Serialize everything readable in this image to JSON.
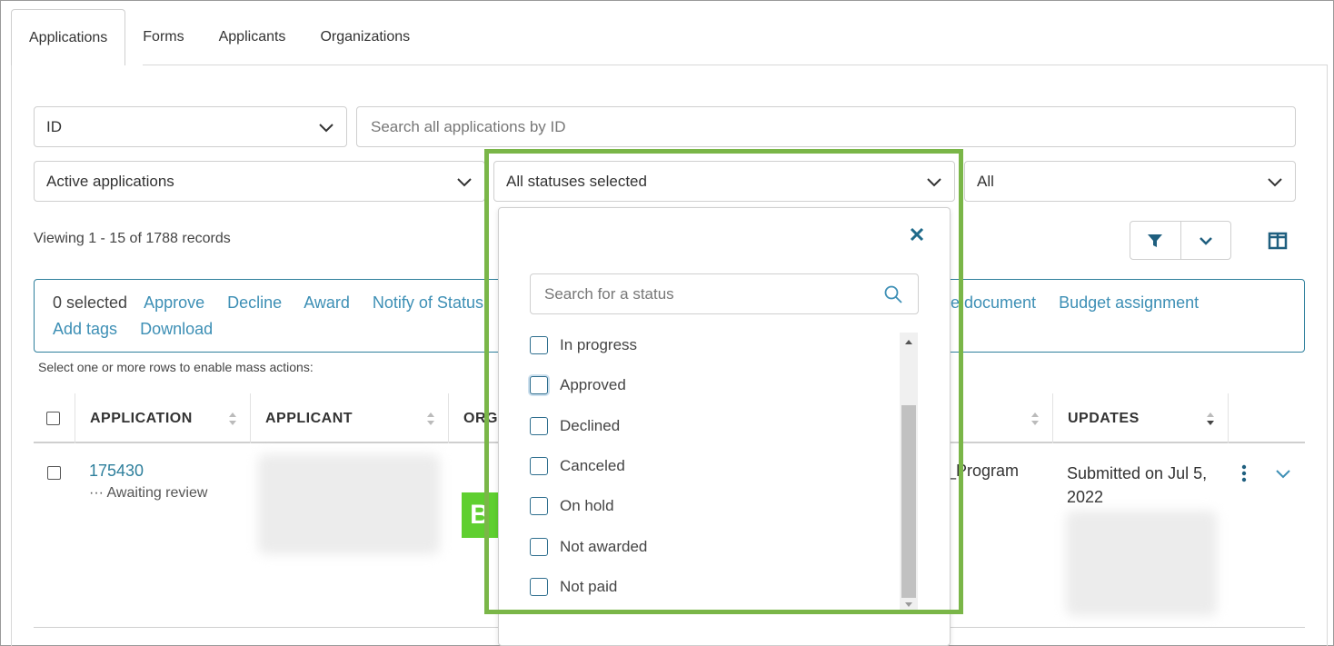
{
  "tabs": [
    {
      "label": "Applications"
    },
    {
      "label": "Forms"
    },
    {
      "label": "Applicants"
    },
    {
      "label": "Organizations"
    }
  ],
  "search": {
    "field_select": "ID",
    "placeholder": "Search all applications by ID"
  },
  "filters": {
    "applications": "Active applications",
    "statuses": "All statuses selected",
    "third": "All"
  },
  "records_text": "Viewing 1 - 15 of 1788 records",
  "mass_actions": {
    "selected": "0 selected",
    "actions": [
      "Approve",
      "Decline",
      "Award",
      "Notify of Status"
    ],
    "right_actions": [
      "e document",
      "Budget assignment"
    ],
    "row2": [
      "Add tags",
      "Download"
    ],
    "hint": "Select one or more rows to enable mass actions:"
  },
  "table": {
    "headers": [
      "APPLICATION",
      "APPLICANT",
      "ORGA",
      "UPDATES"
    ],
    "row": {
      "id": "175430",
      "status": "··· Awaiting review",
      "logo_text": "B",
      "program": "_Program",
      "updates": "Submitted on Jul 5, 2022"
    }
  },
  "status_dropdown": {
    "search_placeholder": "Search for a status",
    "options": [
      "In progress",
      "Approved",
      "Declined",
      "Canceled",
      "On hold",
      "Not awarded",
      "Not paid"
    ]
  },
  "colors": {
    "accent": "#2e7f9c",
    "link": "#3d8fb5",
    "highlight": "#7ab648"
  }
}
